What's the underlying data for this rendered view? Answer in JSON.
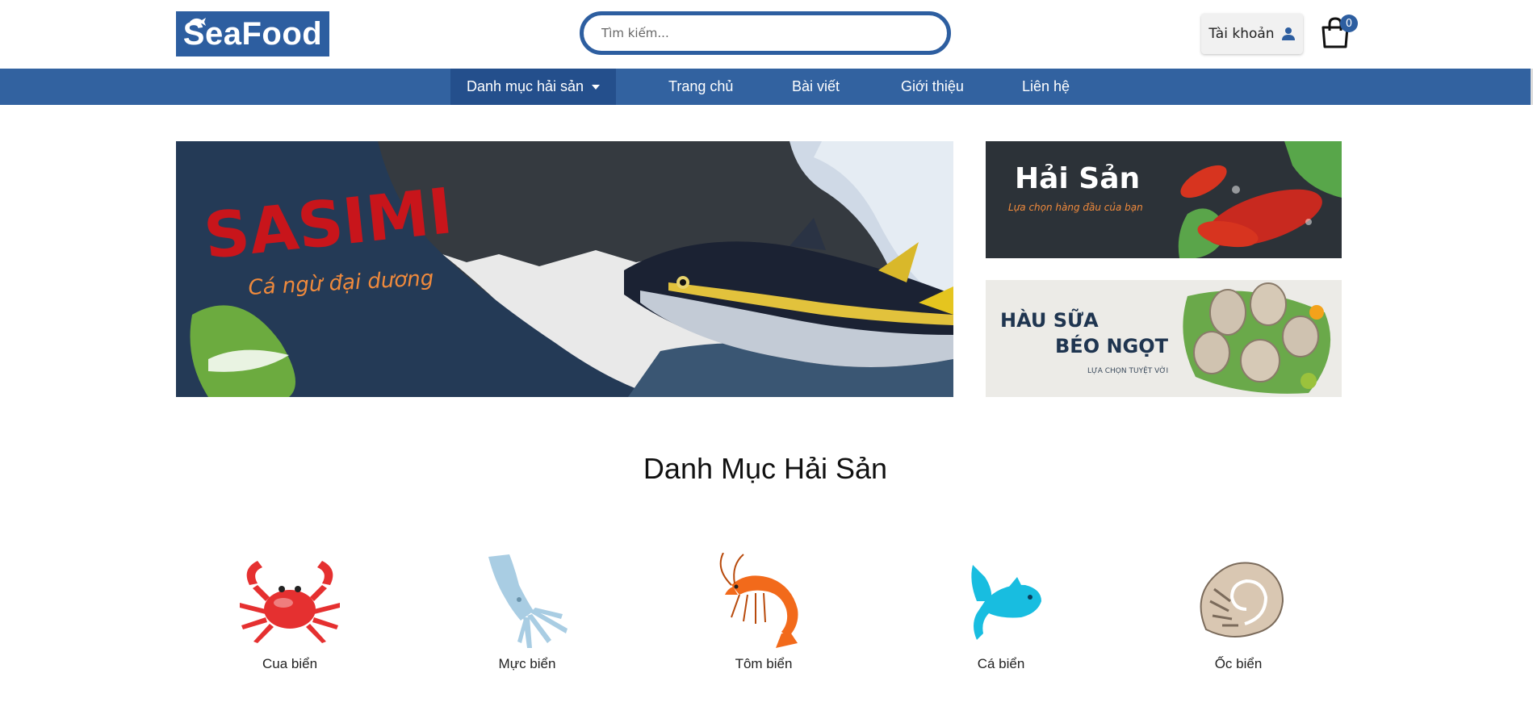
{
  "header": {
    "logo_text": "SeaFood",
    "search_placeholder": "Tìm kiếm...",
    "account_label": "Tài khoản",
    "cart_count": "0"
  },
  "nav": {
    "items": [
      {
        "label": "Danh mục hải sản",
        "dropdown": true
      },
      {
        "label": "Trang chủ"
      },
      {
        "label": "Bài viết"
      },
      {
        "label": "Giới thiệu"
      },
      {
        "label": "Liên hệ"
      }
    ]
  },
  "banners": {
    "main": {
      "title": "SASIMI",
      "subtitle": "Cá ngừ đại dương"
    },
    "side1": {
      "title": "Hải Sản",
      "subtitle": "Lựa chọn hàng đầu của bạn"
    },
    "side2": {
      "line1": "HÀU SỮA",
      "line2": "BÉO NGỌT",
      "subtitle": "LỰA CHỌN TUYỆT VỜI"
    }
  },
  "categories": {
    "title": "Danh Mục Hải Sản",
    "items": [
      {
        "label": "Cua biển",
        "icon": "crab-icon"
      },
      {
        "label": "Mực biển",
        "icon": "squid-icon"
      },
      {
        "label": "Tôm biển",
        "icon": "shrimp-icon"
      },
      {
        "label": "Cá biển",
        "icon": "fish-icon"
      },
      {
        "label": "Ốc biển",
        "icon": "snail-icon"
      }
    ]
  },
  "colors": {
    "brand": "#2d5ea0",
    "nav_bg": "#3262a0",
    "nav_active": "#244f8c",
    "sasimi_red": "#c8151b",
    "accent_orange": "#f08a3c"
  }
}
